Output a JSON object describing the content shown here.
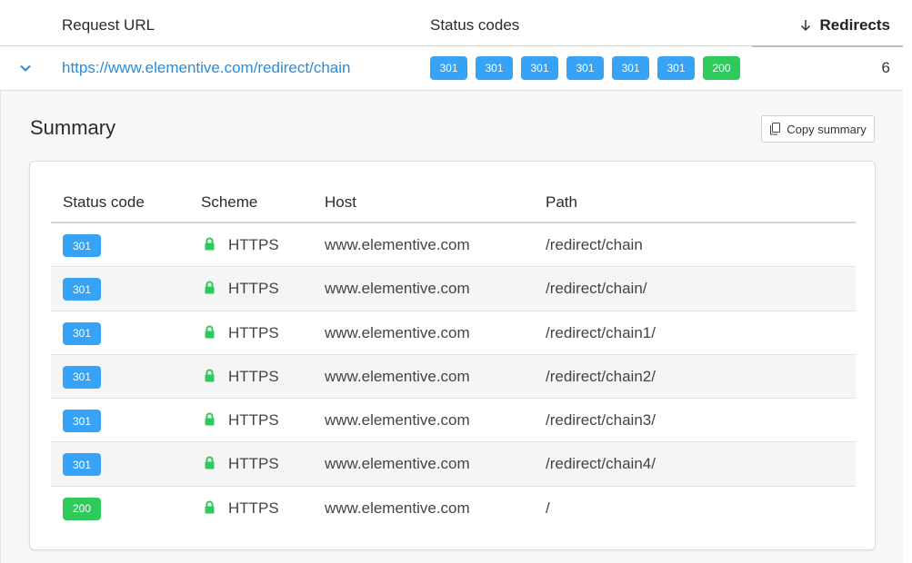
{
  "header": {
    "request_url_label": "Request URL",
    "status_codes_label": "Status codes",
    "redirects_label": "Redirects"
  },
  "request": {
    "url": "https://www.elementive.com/redirect/chain",
    "status_codes": [
      "301",
      "301",
      "301",
      "301",
      "301",
      "301",
      "200"
    ],
    "redirects": "6"
  },
  "summary": {
    "title": "Summary",
    "copy_button_label": "Copy summary",
    "columns": [
      "Status code",
      "Scheme",
      "Host",
      "Path"
    ],
    "rows": [
      {
        "code": "301",
        "scheme": "HTTPS",
        "host": "www.elementive.com",
        "path": "/redirect/chain"
      },
      {
        "code": "301",
        "scheme": "HTTPS",
        "host": "www.elementive.com",
        "path": "/redirect/chain/"
      },
      {
        "code": "301",
        "scheme": "HTTPS",
        "host": "www.elementive.com",
        "path": "/redirect/chain1/"
      },
      {
        "code": "301",
        "scheme": "HTTPS",
        "host": "www.elementive.com",
        "path": "/redirect/chain2/"
      },
      {
        "code": "301",
        "scheme": "HTTPS",
        "host": "www.elementive.com",
        "path": "/redirect/chain3/"
      },
      {
        "code": "301",
        "scheme": "HTTPS",
        "host": "www.elementive.com",
        "path": "/redirect/chain4/"
      },
      {
        "code": "200",
        "scheme": "HTTPS",
        "host": "www.elementive.com",
        "path": "/"
      }
    ]
  },
  "icons": {
    "expand": "chevron-down-icon",
    "sort": "arrow-down-icon",
    "copy": "copy-icon",
    "secure": "lock-icon"
  },
  "colors": {
    "link": "#2a8bd8",
    "status_301": "#36a3f7",
    "status_200": "#2fca5c",
    "lock": "#2fca5c"
  }
}
